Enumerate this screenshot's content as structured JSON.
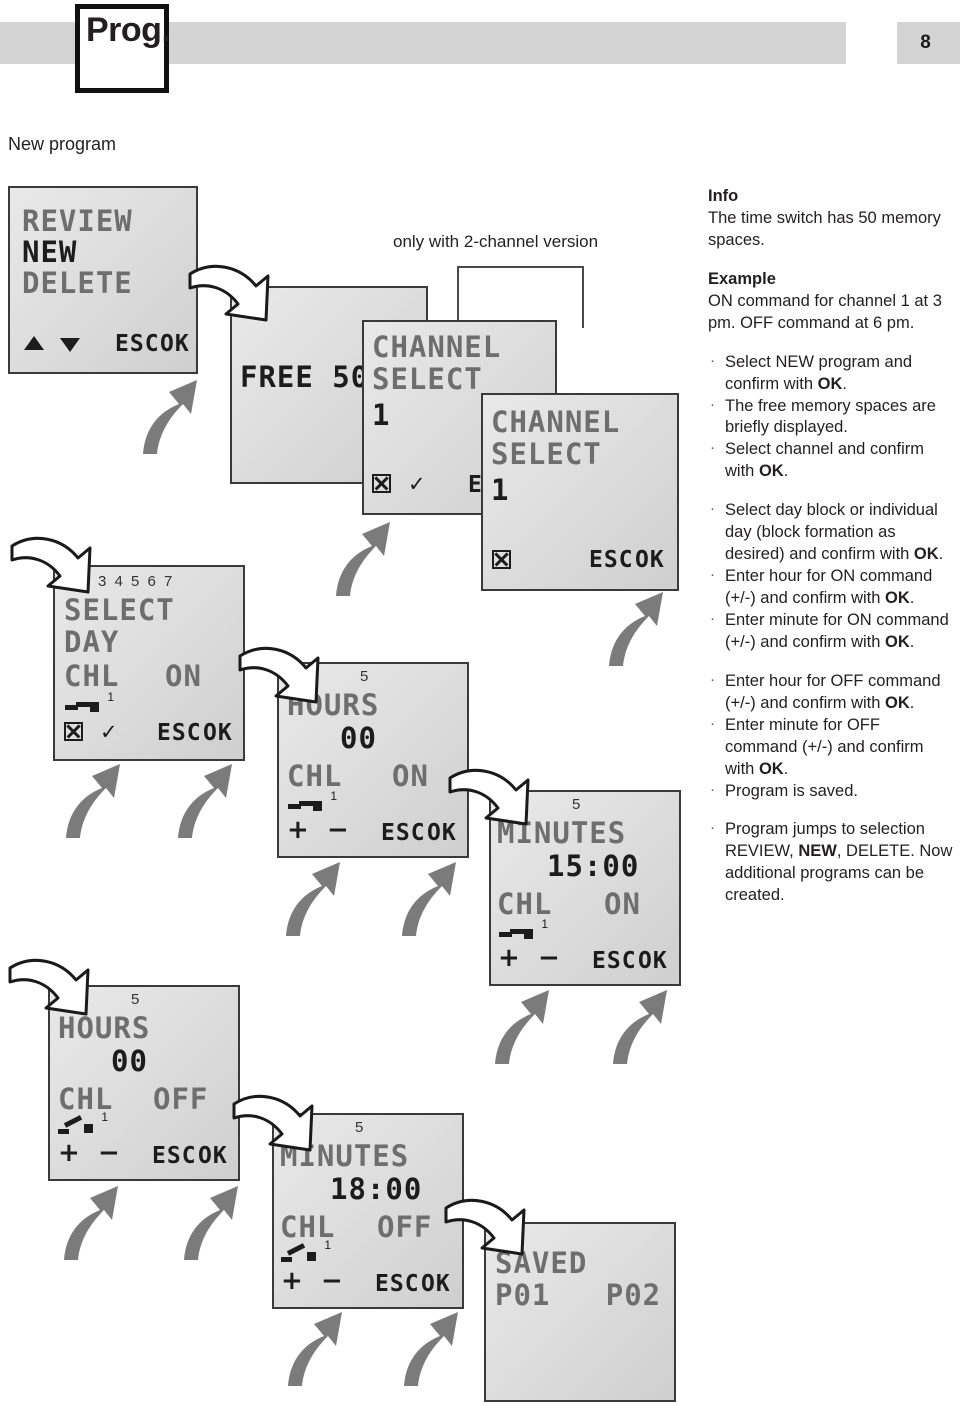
{
  "header": {
    "tab_label": "Prog.",
    "page_number": "8"
  },
  "section": {
    "title": "New program",
    "note_2channel": "only with 2-channel version"
  },
  "screens": [
    {
      "name": "review-new-delete",
      "lines": [
        "REVIEW",
        "NEW",
        "DELETE"
      ],
      "softkeys": [
        "ESC",
        "OK"
      ],
      "icons": [
        "triangle-up",
        "triangle-down"
      ]
    },
    {
      "name": "free-memory",
      "lines": [
        "FREE 50"
      ],
      "softkeys": [],
      "icons": []
    },
    {
      "name": "channel-select-1",
      "lines": [
        "CHANNEL",
        "SELECT",
        "1"
      ],
      "softkeys": [
        "ESC",
        "OK"
      ],
      "icons": [
        "x-box",
        "check"
      ]
    },
    {
      "name": "channel-select-2",
      "lines": [
        "CHANNEL",
        "SELECT",
        "1"
      ],
      "softkeys": [
        "ESC",
        "OK"
      ],
      "icons": [
        "x-box"
      ]
    },
    {
      "name": "select-day",
      "day_ruler": "1 2 3 4 5 6 7",
      "lines": [
        "SELECT",
        "DAY"
      ],
      "channel_label": "CHL",
      "state": "ON",
      "relay": "closed",
      "relay_number": "1",
      "softkeys": [
        "ESC",
        "OK"
      ],
      "icons": [
        "x-box",
        "check"
      ]
    },
    {
      "name": "hours-on",
      "memory_slot": "5",
      "lines": [
        "HOURS"
      ],
      "value": "00",
      "channel_label": "CHL",
      "state": "ON",
      "relay": "closed",
      "relay_number": "1",
      "keys": [
        "+",
        "−"
      ],
      "softkeys": [
        "ESC",
        "OK"
      ]
    },
    {
      "name": "minutes-on",
      "memory_slot": "5",
      "lines": [
        "MINUTES"
      ],
      "value": "15:00",
      "channel_label": "CHL",
      "state": "ON",
      "relay": "closed",
      "relay_number": "1",
      "keys": [
        "+",
        "−"
      ],
      "softkeys": [
        "ESC",
        "OK"
      ]
    },
    {
      "name": "hours-off",
      "memory_slot": "5",
      "lines": [
        "HOURS"
      ],
      "value": "00",
      "channel_label": "CHL",
      "state": "OFF",
      "relay": "open",
      "relay_number": "1",
      "keys": [
        "+",
        "−"
      ],
      "softkeys": [
        "ESC",
        "OK"
      ]
    },
    {
      "name": "minutes-off",
      "memory_slot": "5",
      "lines": [
        "MINUTES"
      ],
      "value": "18:00",
      "channel_label": "CHL",
      "state": "OFF",
      "relay": "open",
      "relay_number": "1",
      "keys": [
        "+",
        "−"
      ],
      "softkeys": [
        "ESC",
        "OK"
      ]
    },
    {
      "name": "saved",
      "lines": [
        "SAVED",
        "P01   P02"
      ],
      "softkeys": [],
      "icons": []
    }
  ],
  "info": {
    "heading": "Info",
    "body": "The time switch has 50 memory spaces.",
    "example_heading": "Example",
    "example_body": "ON command for channel 1 at 3 pm. OFF command at 6 pm."
  },
  "steps": [
    {
      "text_a": "Select NEW program and confirm with ",
      "bold": "OK",
      "text_b": ".",
      "spaced": false
    },
    {
      "text_a": "The free memory spaces are briefly displayed.",
      "bold": "",
      "text_b": "",
      "spaced": false
    },
    {
      "text_a": "Select channel and confirm with ",
      "bold": "OK",
      "text_b": ".",
      "spaced": false
    },
    {
      "text_a": "Select day block or individual day (block formation as desired) and confirm with ",
      "bold": "OK",
      "text_b": ".",
      "spaced": true
    },
    {
      "text_a": "Enter hour for ON command (+/-) and confirm with ",
      "bold": "OK",
      "text_b": ".",
      "spaced": false
    },
    {
      "text_a": "Enter minute for ON command (+/-) and confirm with ",
      "bold": "OK",
      "text_b": ".",
      "spaced": false
    },
    {
      "text_a": "Enter hour for OFF command (+/-) and confirm with ",
      "bold": "OK",
      "text_b": ".",
      "spaced": true
    },
    {
      "text_a": "Enter minute for OFF command (+/-) and confirm with ",
      "bold": "OK",
      "text_b": ".",
      "spaced": false
    },
    {
      "text_a": "Program is saved.",
      "bold": "",
      "text_b": "",
      "spaced": false
    },
    {
      "text_a": "Program jumps to selection REVIEW, ",
      "bold": "NEW",
      "text_b": ", DELETE. Now additional programs can be created.",
      "spaced": true
    }
  ],
  "colors": {
    "header_gray": "#d4d4d4",
    "lcd_text": "#6e6e6e",
    "lcd_text_dark": "#1c1c1c",
    "arrow_gray": "#7b7b7b",
    "ink": "#231f20"
  }
}
